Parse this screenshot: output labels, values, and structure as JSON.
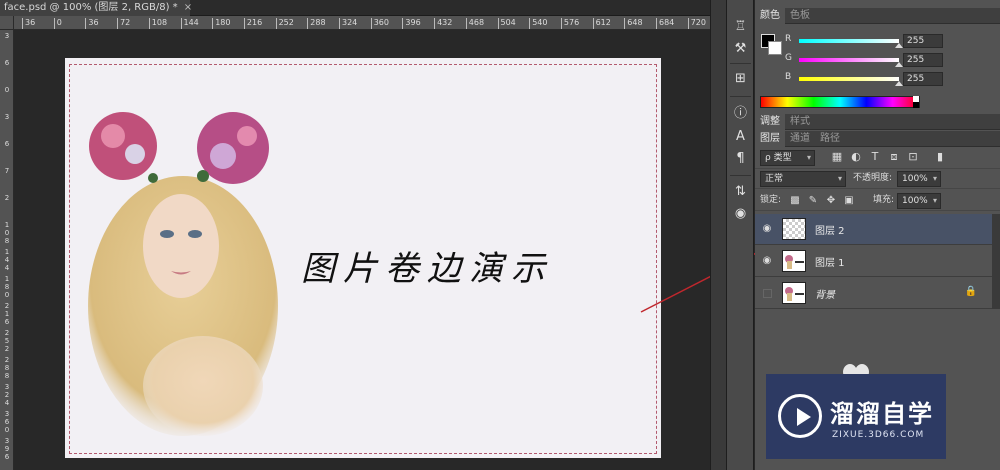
{
  "document": {
    "tab_title": "face.psd @ 100% (图层 2, RGB/8) *",
    "close": "×"
  },
  "rulers": {
    "horizontal_ticks": [
      "36",
      "0",
      "36",
      "72",
      "108",
      "144",
      "180",
      "216",
      "252",
      "288",
      "324",
      "360",
      "396",
      "432",
      "468",
      "504",
      "540",
      "576",
      "612",
      "648",
      "684",
      "720"
    ],
    "vertical_ticks": [
      "3",
      "6",
      "0",
      "3",
      "6",
      "7",
      "2",
      "1 0 8",
      "1 4 4",
      "1 8 0",
      "2 1 6",
      "2 5 2",
      "2 8 8",
      "3 2 4",
      "3 6 0",
      "3 9 6"
    ]
  },
  "canvas": {
    "title_text": "图片卷边演示",
    "portrait_label": "woman with flower crown"
  },
  "color_panel": {
    "tabs": [
      "颜色",
      "色板"
    ],
    "r_label": "R",
    "r_value": "255",
    "g_label": "G",
    "g_value": "255",
    "b_label": "B",
    "b_value": "255",
    "fg_color": "#000000",
    "bg_color": "#ffffff"
  },
  "adjust_panel": {
    "tabs": [
      "调整",
      "样式"
    ]
  },
  "layers_panel": {
    "tabs": [
      "图层",
      "通道",
      "路径"
    ],
    "filter_kind": "ρ 类型",
    "blend_mode": "正常",
    "opacity_label": "不透明度:",
    "opacity_value": "100%",
    "lock_label": "锁定:",
    "fill_label": "填充:",
    "fill_value": "100%",
    "layers": [
      {
        "name": "图层 2",
        "selected": true,
        "visible": true
      },
      {
        "name": "图层 1",
        "selected": false,
        "visible": true
      },
      {
        "name": "背景",
        "selected": false,
        "visible": false,
        "locked": true
      }
    ]
  },
  "watermark": {
    "title": "溜溜自学",
    "url": "ZIXUE.3D66.COM"
  },
  "colors": {
    "annotation": "#c0272d",
    "selected_layer": "#485266"
  }
}
